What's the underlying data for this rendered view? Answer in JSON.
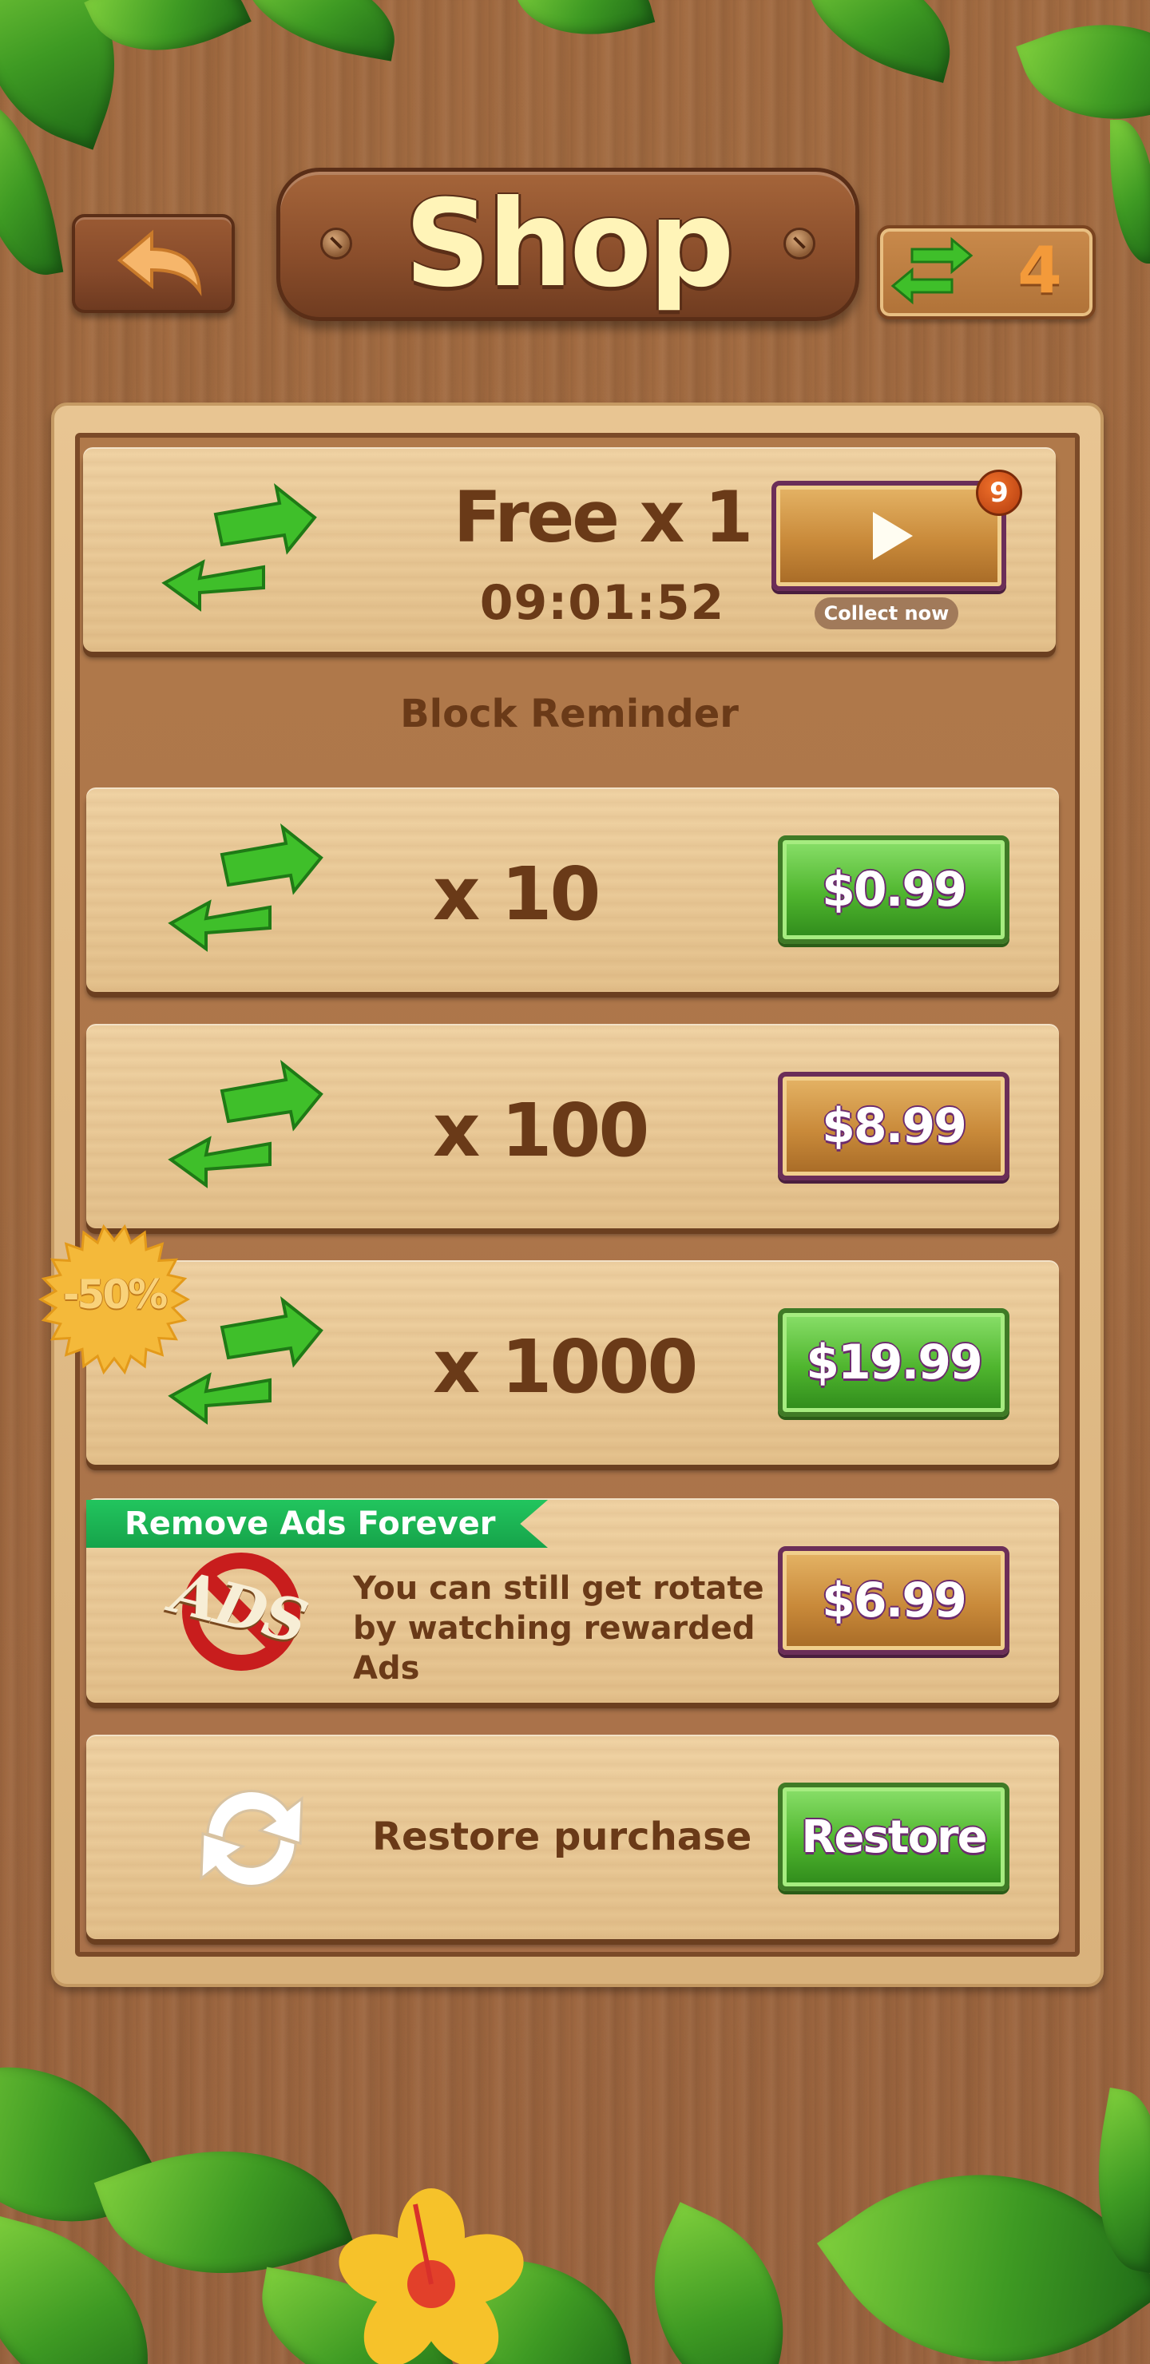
{
  "header": {
    "title": "Shop",
    "reminder_count": "4"
  },
  "free_offer": {
    "label": "Free x 1",
    "timer": "09:01:52",
    "badge": "9",
    "collect_label": "Collect now"
  },
  "section": {
    "title": "Block Reminder"
  },
  "packs": [
    {
      "label": "x 10",
      "price": "$0.99",
      "style": "green"
    },
    {
      "label": "x 100",
      "price": "$8.99",
      "style": "brown"
    },
    {
      "label": "x 1000",
      "price": "$19.99",
      "style": "green",
      "discount": "-50%"
    }
  ],
  "remove_ads": {
    "ribbon": "Remove Ads Forever",
    "logo_text": "ADS",
    "description_lines": [
      "You can still get rotate",
      "by watching rewarded",
      "Ads"
    ],
    "price": "$6.99"
  },
  "restore": {
    "label": "Restore purchase",
    "button": "Restore"
  },
  "colors": {
    "green_button": "#4fb52e",
    "brown_button": "#c98a3a",
    "ribbon": "#16a34a",
    "text_brown": "#6a3a18",
    "title": "#fff4b8",
    "accent_orange": "#e07a2e"
  },
  "icons": [
    "back-arrow-icon",
    "swap-arrows-icon",
    "play-icon",
    "no-ads-icon",
    "restore-cycle-icon",
    "discount-starburst-icon",
    "flower-icon"
  ]
}
